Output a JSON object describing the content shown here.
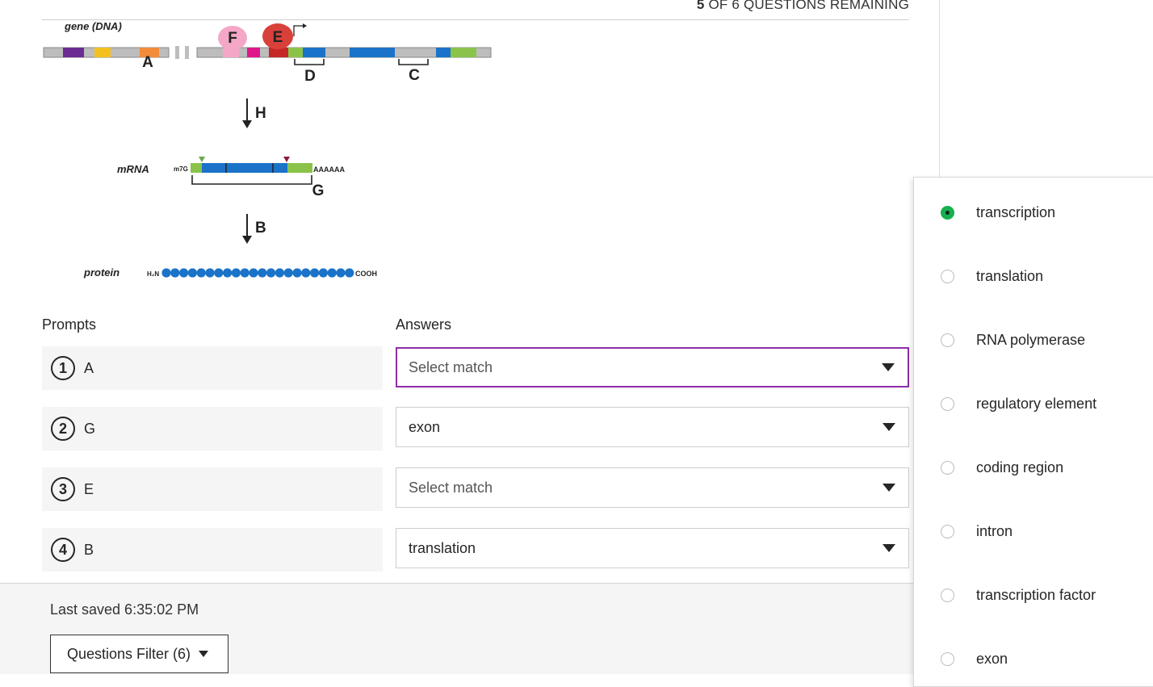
{
  "header": {
    "remaining_count": "5",
    "remaining_text": "OF 6 QUESTIONS REMAINING"
  },
  "diagram": {
    "gene_label": "gene (DNA)",
    "mrna_label": "mRNA",
    "protein_label": "protein",
    "cap": "m7G",
    "polyA": "AAAAAA",
    "n_term": "H₂N",
    "c_term": "COOH",
    "letters": {
      "a": "A",
      "b": "B",
      "c": "C",
      "d": "D",
      "e": "E",
      "f": "F",
      "g": "G",
      "h": "H"
    }
  },
  "columns": {
    "prompts": "Prompts",
    "answers": "Answers"
  },
  "rows": [
    {
      "number": "1",
      "prompt": "A",
      "answer": "Select match"
    },
    {
      "number": "2",
      "prompt": "G",
      "answer": "exon"
    },
    {
      "number": "3",
      "prompt": "E",
      "answer": "Select match"
    },
    {
      "number": "4",
      "prompt": "B",
      "answer": "translation"
    }
  ],
  "footer": {
    "last_saved": "Last saved 6:35:02 PM",
    "filter_label": "Questions Filter (6)"
  },
  "options": [
    {
      "label": "transcription",
      "selected": true
    },
    {
      "label": "translation",
      "selected": false
    },
    {
      "label": "RNA polymerase",
      "selected": false
    },
    {
      "label": "regulatory element",
      "selected": false
    },
    {
      "label": "coding region",
      "selected": false
    },
    {
      "label": "intron",
      "selected": false
    },
    {
      "label": "transcription factor",
      "selected": false
    },
    {
      "label": "exon",
      "selected": false
    }
  ],
  "colors": {
    "accent_focus": "#8e2ea8",
    "radio_selected": "#16b04e",
    "dna_blue": "#1a73c8",
    "dna_green": "#8bc34a"
  }
}
